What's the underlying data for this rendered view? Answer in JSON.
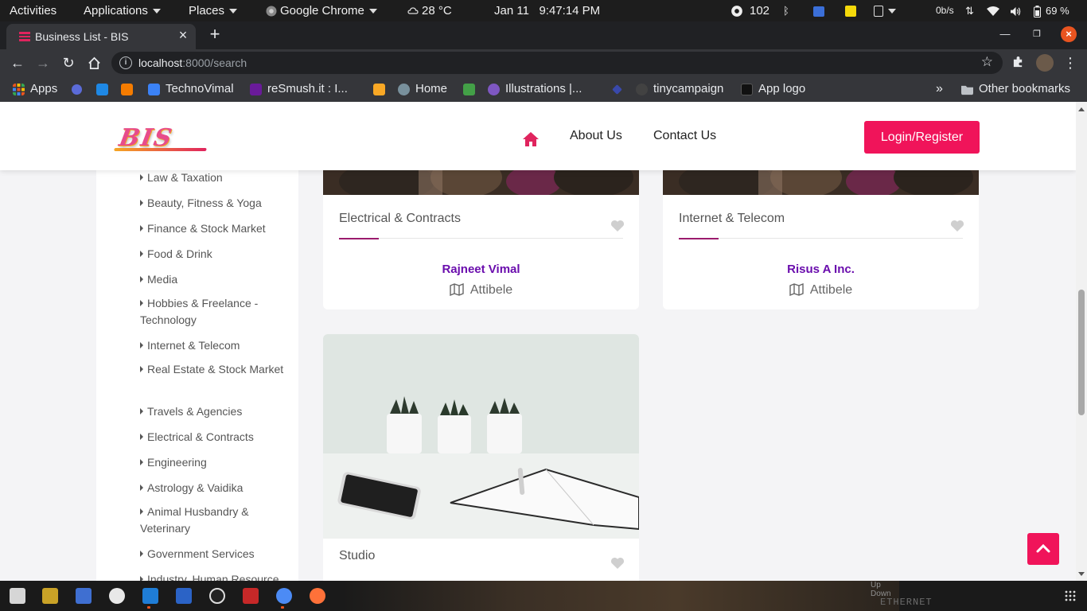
{
  "topbar": {
    "activities": "Activities",
    "applications": "Applications",
    "places": "Places",
    "app": "Google Chrome",
    "weather": "28 °C",
    "date": "Jan 11",
    "time": "9:47:14 PM",
    "notif_count": "102",
    "net_speed": "0b/s",
    "battery": "69 %"
  },
  "browser": {
    "tab_title": "Business List - BIS",
    "url_host": "localhost",
    "url_path": ":8000/search",
    "bookmarks": [
      {
        "label": "Apps",
        "color": "#e95420"
      },
      {
        "label": "",
        "color": "#5b6bd8"
      },
      {
        "label": "",
        "color": "#1e88e5"
      },
      {
        "label": "",
        "color": "#f57c00"
      },
      {
        "label": "TechnoVimal",
        "color": "#3b82f6"
      },
      {
        "label": "reSmush.it : I...",
        "color": "#6a1b9a"
      },
      {
        "label": "",
        "color": "#f9a825"
      },
      {
        "label": "Home",
        "color": "#78909c"
      },
      {
        "label": "",
        "color": "#43a047"
      },
      {
        "label": "Illustrations |...",
        "color": "#7e57c2"
      },
      {
        "label": "",
        "color": "#3949ab"
      },
      {
        "label": "tinycampaign",
        "color": "#424242"
      },
      {
        "label": "App logo",
        "color": "#111111"
      }
    ],
    "other_bookmarks": "Other bookmarks"
  },
  "site": {
    "brand": "BIS",
    "nav": {
      "about": "About Us",
      "contact": "Contact Us",
      "login": "Login/Register"
    },
    "accent": "#f0145a",
    "categories": [
      "Law & Taxation",
      "Beauty, Fitness & Yoga",
      "Finance & Stock Market",
      "Food & Drink",
      "Media",
      "Hobbies & Freelance - Technology",
      "Internet & Telecom",
      "Real Estate & Stock Market",
      "Travels & Agencies",
      "Electrical & Contracts",
      "Engineering",
      "Astrology & Vaidika",
      "Animal Husbandry & Veterinary",
      "Government Services",
      "Industry, Human Resource"
    ],
    "listings": [
      {
        "category": "Electrical & Contracts",
        "business": "Rajneet Vimal",
        "location": "Attibele"
      },
      {
        "category": "Internet & Telecom",
        "business": "Risus A Inc.",
        "location": "Attibele"
      },
      {
        "category": "Studio",
        "business": "",
        "location": ""
      }
    ]
  },
  "dock": {
    "net_up": "Up",
    "net_down": "Down",
    "net_iface": "ETHERNET"
  }
}
